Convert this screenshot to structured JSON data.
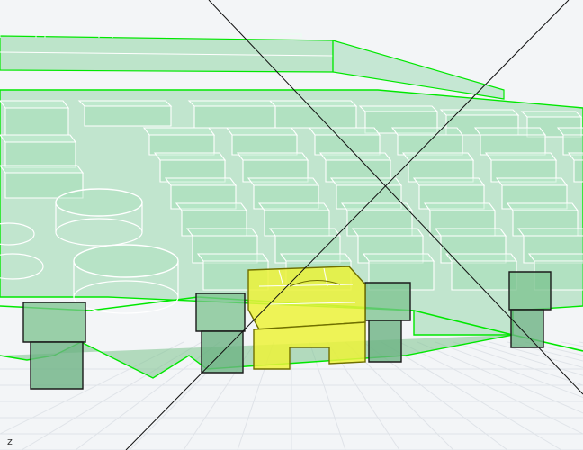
{
  "viewport": {
    "axis_indicator": "z",
    "background_color": "#f3f5f7",
    "grid_color": "#dfe3e8"
  },
  "model": {
    "body_fill": "#8fd6a6",
    "edge_color": "#00e800",
    "highlight_edge": "#ffffff",
    "selected_fill": "#ecf23a",
    "selected_edge": "#8a8a00",
    "front_block_fill": "#7bc28e",
    "front_block_edge": "#1a1a1a"
  },
  "crosshair": {
    "line_color": "#111111"
  }
}
